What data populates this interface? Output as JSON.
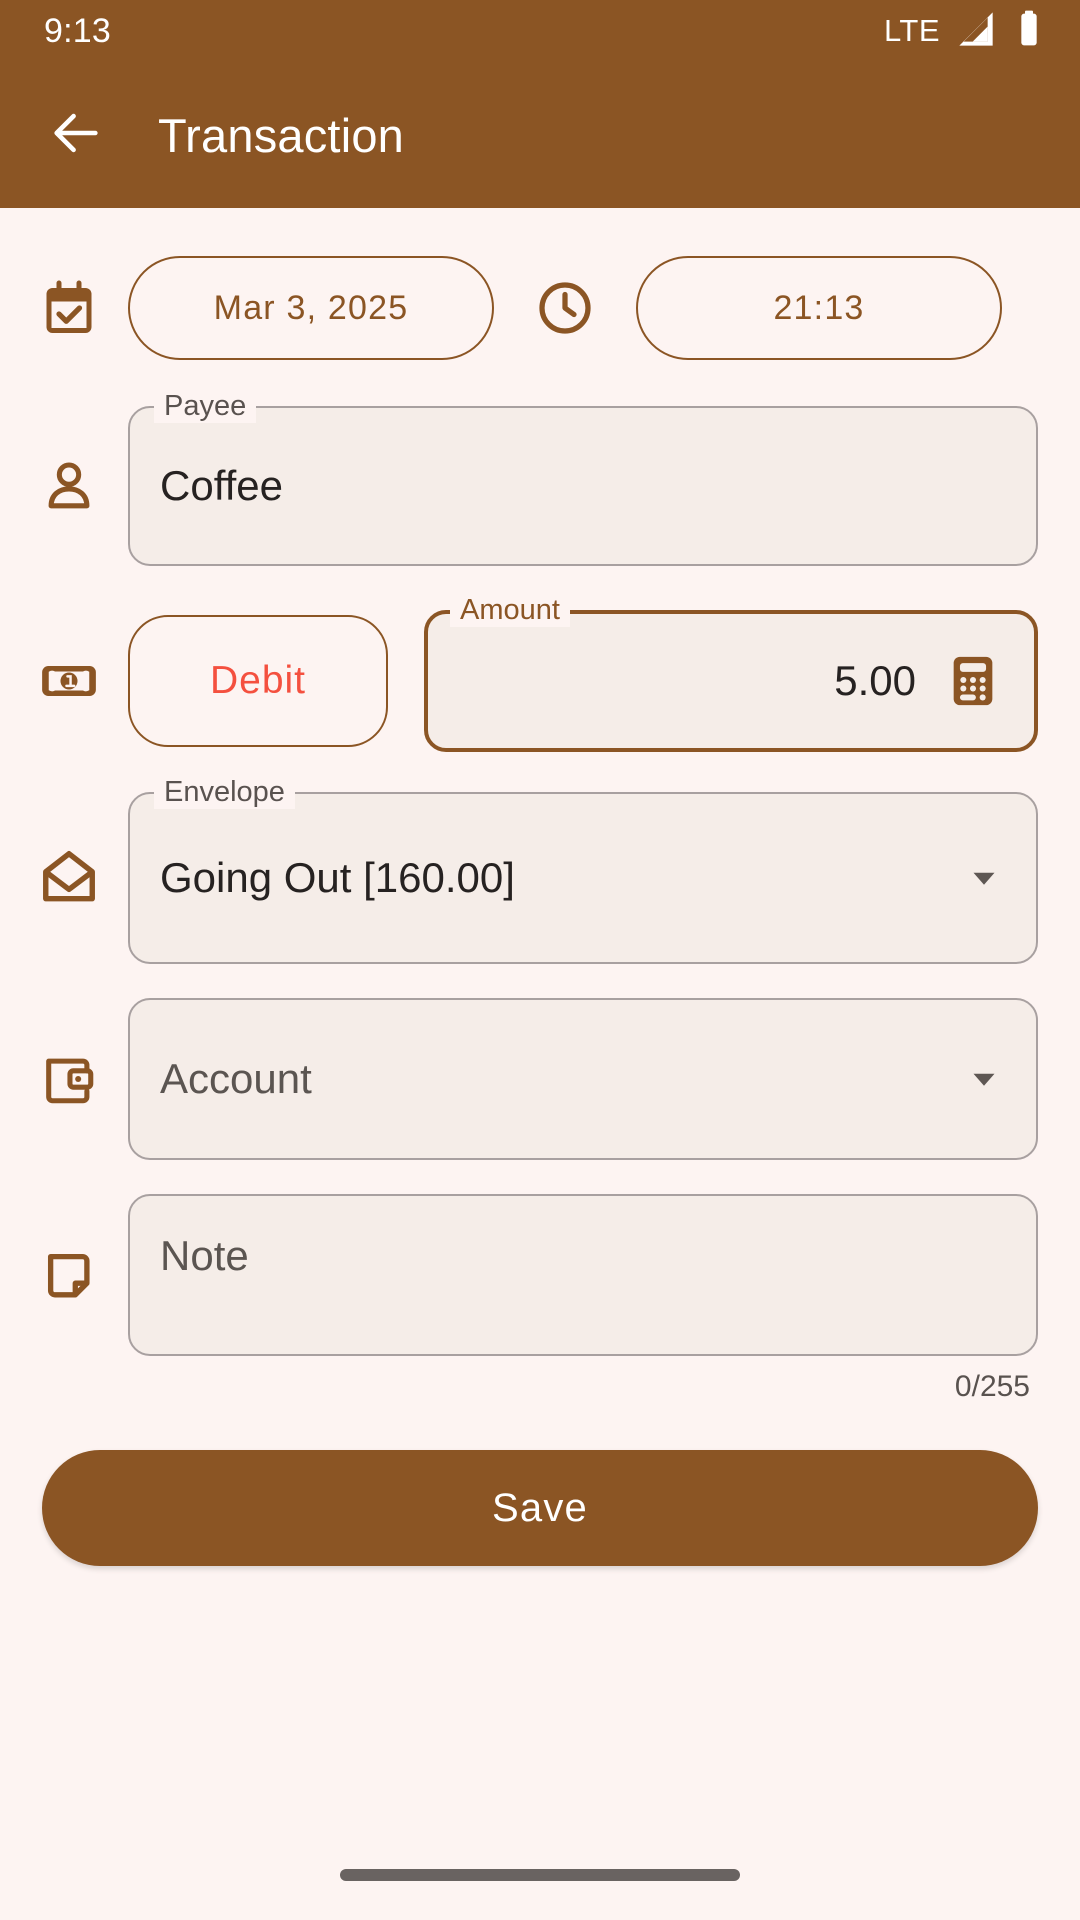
{
  "status_bar": {
    "clock": "9:13",
    "network_label": "LTE",
    "signal_icon": "signal-triangle-icon",
    "battery_icon": "battery-full-icon"
  },
  "app_bar": {
    "back_icon": "arrow-back-icon",
    "title": "Transaction"
  },
  "colors": {
    "brand_brown": "#8B5524",
    "page_background": "#FDF4F2",
    "field_fill": "#F5EDE8",
    "field_outline": "#A8A0A0",
    "debit_red": "#F4503F",
    "text_primary": "#262221",
    "label_gray": "#59524F"
  },
  "form": {
    "datetime": {
      "calendar_icon": "calendar-check-icon",
      "date_value": "Mar 3, 2025",
      "clock_icon": "clock-icon",
      "time_value": "21:13"
    },
    "payee": {
      "icon": "person-icon",
      "label": "Payee",
      "value": "Coffee",
      "placeholder": "Payee"
    },
    "amount": {
      "icon": "banknote-icon",
      "type_toggle_label": "Debit",
      "label": "Amount",
      "value": "5.00",
      "placeholder": "Amount",
      "calculator_icon": "calculator-icon",
      "focused": true
    },
    "envelope": {
      "icon": "envelope-icon",
      "label": "Envelope",
      "value": "Going Out [160.00]",
      "dropdown_icon": "chevron-down-icon"
    },
    "account": {
      "icon": "wallet-icon",
      "label": "Account",
      "value": "Account",
      "placeholder": "Account",
      "dropdown_icon": "chevron-down-icon"
    },
    "note": {
      "icon": "note-icon",
      "label": "Note",
      "value": "",
      "placeholder": "Note",
      "char_counter": "0/255"
    }
  },
  "actions": {
    "save_label": "Save"
  },
  "system_nav": {
    "gesture_bar": "gesture-bar"
  }
}
